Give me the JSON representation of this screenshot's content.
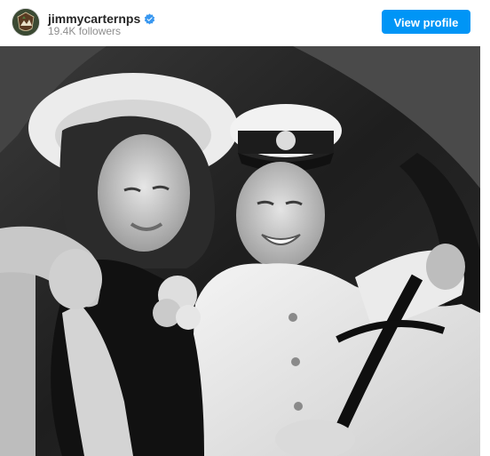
{
  "post": {
    "username": "jimmycarternps",
    "followers": "19.4K followers",
    "view_profile_label": "View profile",
    "verified": true,
    "avatar_icon": "nps-arrowhead-icon",
    "verified_icon": "verified-badge-icon"
  },
  "colors": {
    "button_blue": "#0095f6",
    "text_primary": "#262626",
    "text_secondary": "#8e8e8e",
    "verified_blue": "#3897f0"
  }
}
